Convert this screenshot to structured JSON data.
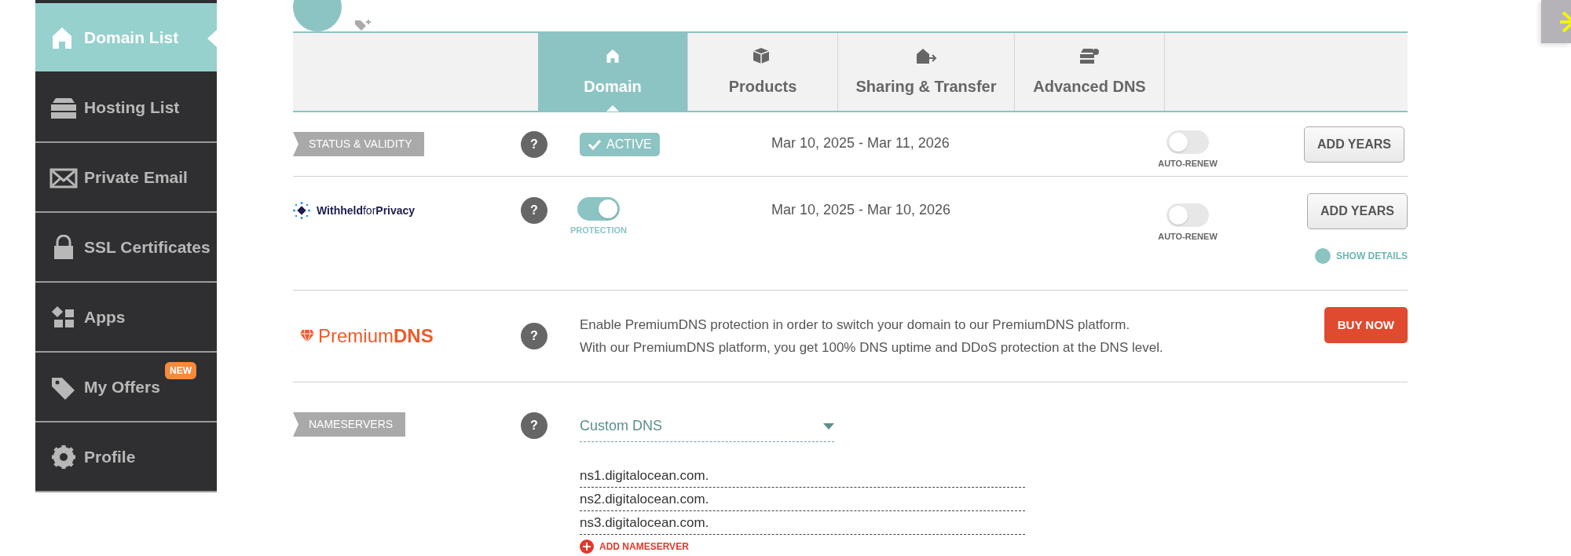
{
  "sidebar": {
    "items": [
      {
        "label": "Domain List",
        "selected": true
      },
      {
        "label": "Hosting List",
        "selected": false
      },
      {
        "label": "Private Email",
        "selected": false
      },
      {
        "label": "SSL Certificates",
        "selected": false
      },
      {
        "label": "Apps",
        "selected": false
      },
      {
        "label": "My Offers",
        "selected": false,
        "badge": "NEW"
      },
      {
        "label": "Profile",
        "selected": false
      }
    ]
  },
  "tabs": [
    {
      "label": "Domain",
      "selected": true
    },
    {
      "label": "Products",
      "selected": false
    },
    {
      "label": "Sharing & Transfer",
      "selected": false
    },
    {
      "label": "Advanced DNS",
      "selected": false
    }
  ],
  "status_validity": {
    "label": "STATUS & VALIDITY",
    "help": "?",
    "status": "ACTIVE",
    "dates": "Mar 10, 2025 - Mar 11, 2026",
    "auto_renew": {
      "label": "AUTO-RENEW",
      "on": false
    },
    "button": "ADD YEARS"
  },
  "privacy": {
    "logo": "**Withheld**for**Privacy**",
    "help": "?",
    "protection": {
      "label": "PROTECTION",
      "on": true
    },
    "dates": "Mar 10, 2025 - Mar 10, 2026",
    "auto_renew": {
      "label": "AUTO-RENEW",
      "on": false
    },
    "button": "ADD YEARS",
    "show_details": "SHOW DETAILS"
  },
  "premium_dns": {
    "logo": "Premium**DNS**",
    "help": "?",
    "description": [
      "Enable PremiumDNS protection in order to switch your domain to our PremiumDNS platform.",
      "With our PremiumDNS platform, you get 100% DNS uptime and DDoS protection at the DNS level."
    ],
    "button": "BUY NOW"
  },
  "nameservers": {
    "label": "NAMESERVERS",
    "help": "?",
    "type": "Custom DNS",
    "entries": [
      "ns1.digitalocean.com.",
      "ns2.digitalocean.com.",
      "ns3.digitalocean.com."
    ],
    "add": "ADD NAMESERVER"
  }
}
